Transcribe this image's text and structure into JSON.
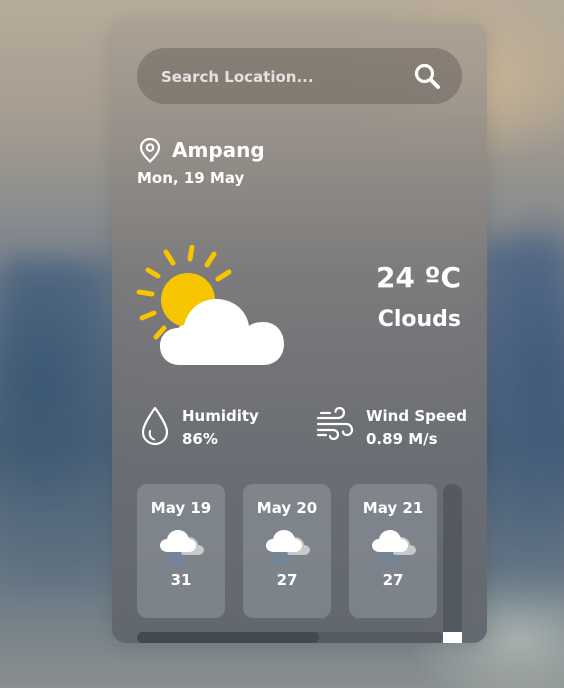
{
  "search": {
    "placeholder": "Search Location...",
    "icon": "search-icon"
  },
  "location": {
    "icon": "map-pin-icon",
    "city": "Ampang",
    "date": "Mon, 19 May"
  },
  "current": {
    "icon": "partly-cloudy-icon",
    "temperature": "24 ºC",
    "description": "Clouds"
  },
  "details": {
    "humidity": {
      "icon": "droplet-icon",
      "label": "Humidity",
      "value": "86%"
    },
    "wind": {
      "icon": "wind-icon",
      "label": "Wind Speed",
      "value": "0.89 M/s"
    }
  },
  "forecast": [
    {
      "date": "May 19",
      "icon": "rain-cloud-icon",
      "temp": "31"
    },
    {
      "date": "May 20",
      "icon": "rain-cloud-icon",
      "temp": "27"
    },
    {
      "date": "May 21",
      "icon": "rain-cloud-icon",
      "temp": "27"
    }
  ],
  "scroll": {
    "horizontal_position": 0.0
  },
  "colors": {
    "sun": "#F6C500",
    "rain_drops": "#4A90D9",
    "text": "#FFFFFF"
  }
}
